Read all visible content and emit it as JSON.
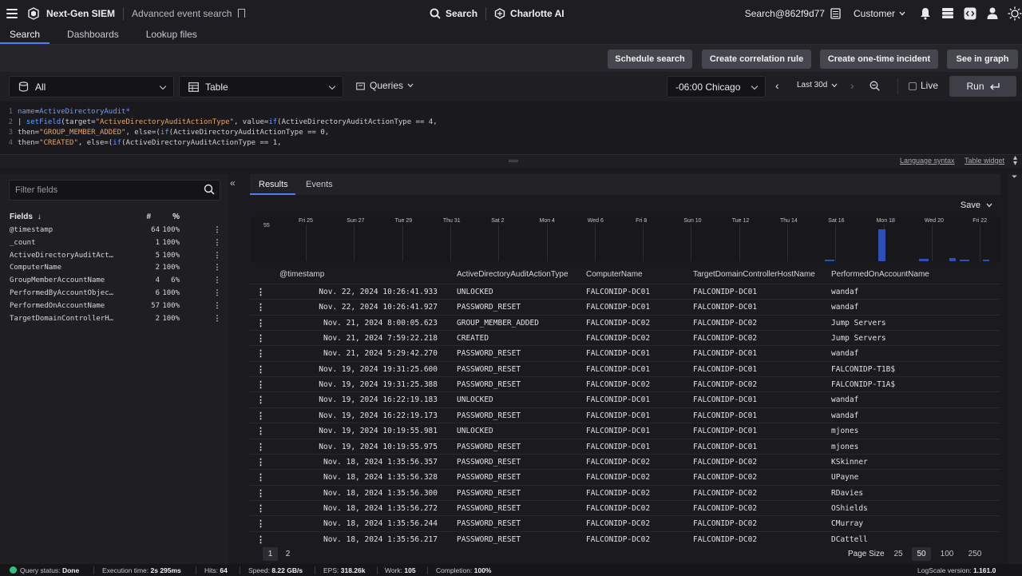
{
  "topbar": {
    "app_title": "Next-Gen SIEM",
    "breadcrumb": "Advanced event search",
    "search_label": "Search",
    "charlotte_label": "Charlotte AI",
    "user_label": "Search@862f9d77",
    "customer_label": "Customer"
  },
  "nav_tabs": [
    "Search",
    "Dashboards",
    "Lookup files"
  ],
  "actions": {
    "schedule": "Schedule search",
    "correlation": "Create correlation rule",
    "incident": "Create one-time incident",
    "graph": "See in graph"
  },
  "controls": {
    "repo": "All",
    "view": "Table",
    "queries": "Queries",
    "timezone": "-06:00 Chicago",
    "range": "Last 30d",
    "live": "Live",
    "run": "Run"
  },
  "query_lines": [
    {
      "n": "1",
      "parts": [
        [
          "kw",
          "name"
        ],
        [
          "plain",
          "="
        ],
        [
          "kw",
          "ActiveDirectoryAudit*"
        ]
      ]
    },
    {
      "n": "2",
      "parts": [
        [
          "plain",
          "| "
        ],
        [
          "fn",
          "setField"
        ],
        [
          "plain",
          "(target="
        ],
        [
          "str",
          "\"ActiveDirectoryAuditActionType\""
        ],
        [
          "plain",
          ", value="
        ],
        [
          "fn",
          "if"
        ],
        [
          "plain",
          "(ActiveDirectoryAuditActionType == 4,"
        ]
      ]
    },
    {
      "n": "3",
      "parts": [
        [
          "plain",
          "then="
        ],
        [
          "str",
          "\"GROUP_MEMBER_ADDED\""
        ],
        [
          "plain",
          ", else=("
        ],
        [
          "fn",
          "if"
        ],
        [
          "plain",
          "(ActiveDirectoryAuditActionType == 0,"
        ]
      ]
    },
    {
      "n": "4",
      "parts": [
        [
          "plain",
          "then="
        ],
        [
          "str",
          "\"CREATED\""
        ],
        [
          "plain",
          ", else=("
        ],
        [
          "fn",
          "if"
        ],
        [
          "plain",
          "(ActiveDirectoryAuditActionType == 1,"
        ]
      ]
    }
  ],
  "strip_links": {
    "syntax": "Language syntax",
    "widget": "Table widget"
  },
  "fields_panel": {
    "filter_placeholder": "Filter fields",
    "col_fields": "Fields",
    "col_count": "#",
    "col_pct": "%",
    "fields": [
      {
        "name": "@timestamp",
        "count": "64",
        "pct": "100%"
      },
      {
        "name": "_count",
        "count": "1",
        "pct": "100%"
      },
      {
        "name": "ActiveDirectoryAuditAct…",
        "count": "5",
        "pct": "100%"
      },
      {
        "name": "ComputerName",
        "count": "2",
        "pct": "100%"
      },
      {
        "name": "GroupMemberAccountName",
        "count": "4",
        "pct": "6%"
      },
      {
        "name": "PerformedByAccountObjec…",
        "count": "6",
        "pct": "100%"
      },
      {
        "name": "PerformedOnAccountName",
        "count": "57",
        "pct": "100%"
      },
      {
        "name": "TargetDomainControllerH…",
        "count": "2",
        "pct": "100%"
      }
    ]
  },
  "results": {
    "tabs": [
      "Results",
      "Events"
    ],
    "save_label": "Save",
    "histogram": {
      "y_label": "55",
      "x_labels": [
        "Fri 25",
        "Sun 27",
        "Tue 29",
        "Thu 31",
        "Sat 2",
        "Mon 4",
        "Wed 6",
        "Fri 8",
        "Sun 10",
        "Tue 12",
        "Thu 14",
        "Sat 16",
        "Mon 18",
        "Wed 20",
        "Fri 22"
      ]
    },
    "columns": [
      "@timestamp",
      "ActiveDirectoryAuditActionType",
      "ComputerName",
      "TargetDomainControllerHostName",
      "PerformedOnAccountName"
    ],
    "rows": [
      [
        "Nov. 22, 2024 10:26:41.933",
        "UNLOCKED",
        "FALCONIDP-DC01",
        "FALCONIDP-DC01",
        "wandaf"
      ],
      [
        "Nov. 22, 2024 10:26:41.927",
        "PASSWORD_RESET",
        "FALCONIDP-DC01",
        "FALCONIDP-DC01",
        "wandaf"
      ],
      [
        "Nov. 21, 2024 8:00:05.623",
        "GROUP_MEMBER_ADDED",
        "FALCONIDP-DC02",
        "FALCONIDP-DC02",
        "Jump Servers"
      ],
      [
        "Nov. 21, 2024 7:59:22.218",
        "CREATED",
        "FALCONIDP-DC02",
        "FALCONIDP-DC02",
        "Jump Servers"
      ],
      [
        "Nov. 21, 2024 5:29:42.270",
        "PASSWORD_RESET",
        "FALCONIDP-DC01",
        "FALCONIDP-DC01",
        "wandaf"
      ],
      [
        "Nov. 19, 2024 19:31:25.600",
        "PASSWORD_RESET",
        "FALCONIDP-DC01",
        "FALCONIDP-DC01",
        "FALCONIDP-T1B$"
      ],
      [
        "Nov. 19, 2024 19:31:25.388",
        "PASSWORD_RESET",
        "FALCONIDP-DC02",
        "FALCONIDP-DC02",
        "FALCONIDP-T1A$"
      ],
      [
        "Nov. 19, 2024 16:22:19.183",
        "UNLOCKED",
        "FALCONIDP-DC01",
        "FALCONIDP-DC01",
        "wandaf"
      ],
      [
        "Nov. 19, 2024 16:22:19.173",
        "PASSWORD_RESET",
        "FALCONIDP-DC01",
        "FALCONIDP-DC01",
        "wandaf"
      ],
      [
        "Nov. 19, 2024 10:19:55.981",
        "UNLOCKED",
        "FALCONIDP-DC01",
        "FALCONIDP-DC01",
        "mjones"
      ],
      [
        "Nov. 19, 2024 10:19:55.975",
        "PASSWORD_RESET",
        "FALCONIDP-DC01",
        "FALCONIDP-DC01",
        "mjones"
      ],
      [
        "Nov. 18, 2024 1:35:56.357",
        "PASSWORD_RESET",
        "FALCONIDP-DC02",
        "FALCONIDP-DC02",
        "KSkinner"
      ],
      [
        "Nov. 18, 2024 1:35:56.328",
        "PASSWORD_RESET",
        "FALCONIDP-DC02",
        "FALCONIDP-DC02",
        "UPayne"
      ],
      [
        "Nov. 18, 2024 1:35:56.300",
        "PASSWORD_RESET",
        "FALCONIDP-DC02",
        "FALCONIDP-DC02",
        "RDavies"
      ],
      [
        "Nov. 18, 2024 1:35:56.272",
        "PASSWORD_RESET",
        "FALCONIDP-DC02",
        "FALCONIDP-DC02",
        "OShields"
      ],
      [
        "Nov. 18, 2024 1:35:56.244",
        "PASSWORD_RESET",
        "FALCONIDP-DC02",
        "FALCONIDP-DC02",
        "CMurray"
      ],
      [
        "Nov. 18, 2024 1:35:56.217",
        "PASSWORD_RESET",
        "FALCONIDP-DC02",
        "FALCONIDP-DC02",
        "DCattell"
      ]
    ],
    "pages": [
      "1",
      "2"
    ],
    "page_size_label": "Page Size",
    "page_sizes": [
      "25",
      "50",
      "100",
      "250"
    ]
  },
  "status": {
    "query_status_label": "Query status:",
    "query_status": "Done",
    "exec_label": "Execution time:",
    "exec": "2s 295ms",
    "hits_label": "Hits:",
    "hits": "64",
    "speed_label": "Speed:",
    "speed": "8.22 GB/s",
    "eps_label": "EPS:",
    "eps": "318.26k",
    "work_label": "Work:",
    "work": "105",
    "completion_label": "Completion:",
    "completion": "100%",
    "version_label": "LogScale version:",
    "version": "1.161.0"
  },
  "colors": {
    "accent": "#4d7cff",
    "histogram_bar": "#2f4fb8",
    "status_ok": "#2ec27e"
  }
}
